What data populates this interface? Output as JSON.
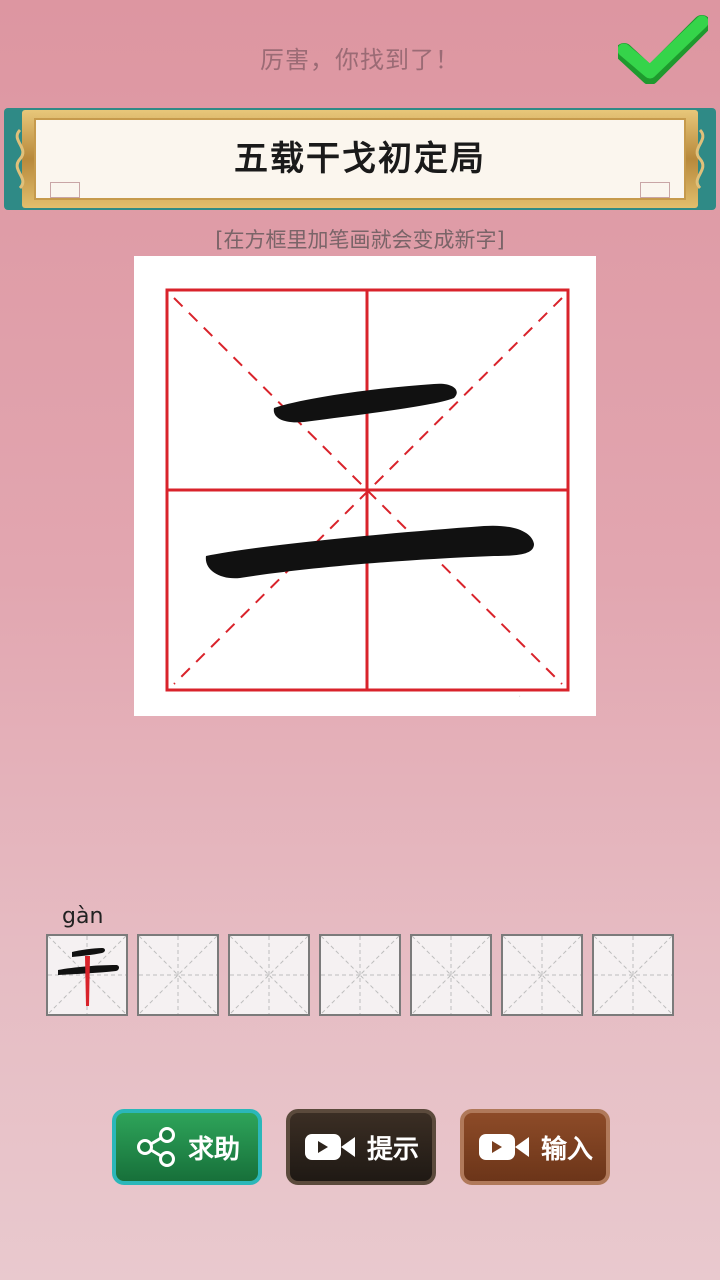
{
  "status_message": "厉害，你找到了！",
  "level_title": "五载干戈初定局",
  "instruction": "[在方框里加笔画就会变成新字]",
  "puzzle": {
    "base_character": "二",
    "icons": {
      "success": "check-icon"
    }
  },
  "answers": {
    "found_pinyin": "gàn",
    "found_character": "干",
    "slot_count": 7
  },
  "buttons": {
    "help_label": "求助",
    "hint_label": "提示",
    "input_label": "输入",
    "help_icon": "share-icon",
    "hint_icon": "video-icon",
    "input_icon": "video-icon"
  },
  "colors": {
    "accent_green": "#2fd24a",
    "grid_red": "#d9232b",
    "help_green": "#1f8a48",
    "hint_dark": "#2c231c",
    "input_brown": "#7a3f1f"
  }
}
